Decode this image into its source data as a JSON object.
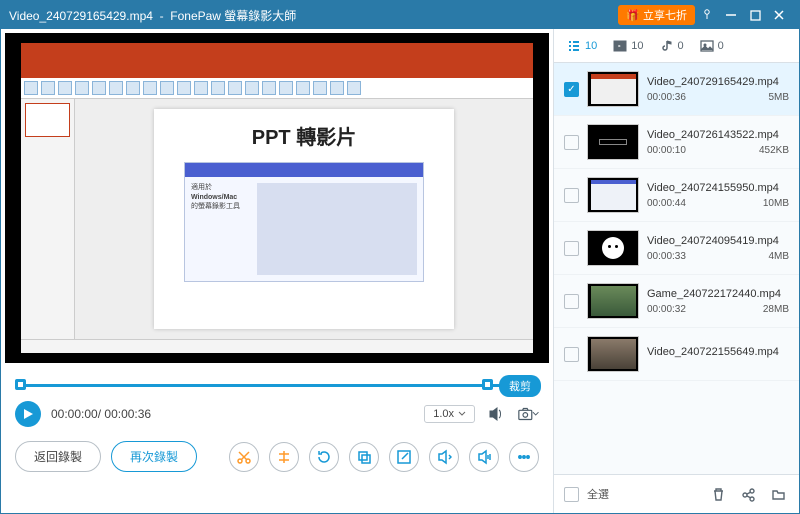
{
  "titlebar": {
    "filename": "Video_240729165429.mp4",
    "app": "FonePaw 螢幕錄影大師",
    "promo": "立享七折"
  },
  "preview": {
    "slide_title": "PPT 轉影片",
    "inset_line1": "適用於",
    "inset_line2": "Windows/Mac",
    "inset_line3": "的螢幕錄影工具"
  },
  "timeline": {
    "trim": "裁剪"
  },
  "playback": {
    "current": "00:00:00",
    "total": "00:00:36",
    "speed": "1.0x"
  },
  "buttons": {
    "back": "返回錄製",
    "again": "再次錄製"
  },
  "tabs": {
    "all_count": "10",
    "video_count": "10",
    "audio_count": "0",
    "image_count": "0"
  },
  "files": [
    {
      "name": "Video_240729165429.mp4",
      "dur": "00:00:36",
      "size": "5MB",
      "selected": true,
      "thumb": "ppt"
    },
    {
      "name": "Video_240726143522.mp4",
      "dur": "00:00:10",
      "size": "452KB",
      "selected": false,
      "thumb": "dark"
    },
    {
      "name": "Video_240724155950.mp4",
      "dur": "00:00:44",
      "size": "10MB",
      "selected": false,
      "thumb": "web"
    },
    {
      "name": "Video_240724095419.mp4",
      "dur": "00:00:33",
      "size": "4MB",
      "selected": false,
      "thumb": "face"
    },
    {
      "name": "Game_240722172440.mp4",
      "dur": "00:00:32",
      "size": "28MB",
      "selected": false,
      "thumb": "game"
    },
    {
      "name": "Video_240722155649.mp4",
      "dur": "",
      "size": "",
      "selected": false,
      "thumb": "game2"
    }
  ],
  "footer": {
    "select_all": "全選"
  }
}
